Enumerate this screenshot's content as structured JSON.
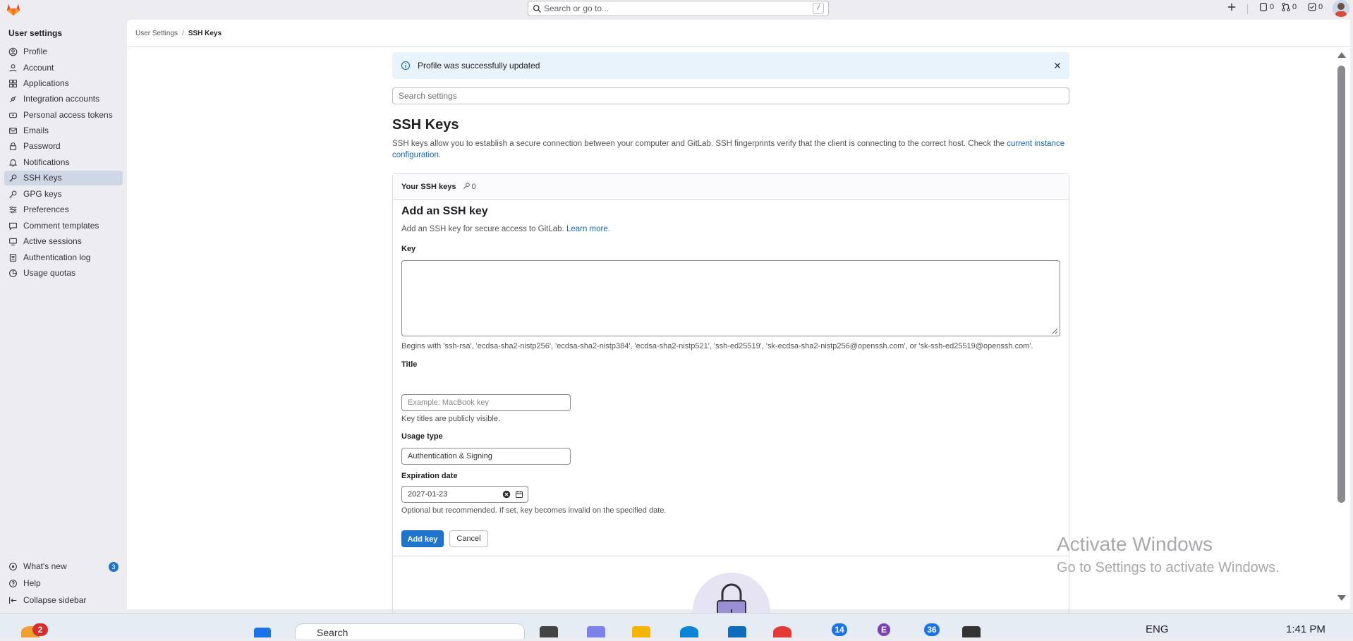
{
  "topbar": {
    "search_placeholder": "Search or go to...",
    "search_shortcut": "/",
    "issues_count": "0",
    "mr_count": "0",
    "todos_count": "0"
  },
  "sidebar": {
    "title": "User settings",
    "items": [
      {
        "label": "Profile",
        "icon": "profile-icon"
      },
      {
        "label": "Account",
        "icon": "account-icon"
      },
      {
        "label": "Applications",
        "icon": "applications-icon"
      },
      {
        "label": "Integration accounts",
        "icon": "integration-icon"
      },
      {
        "label": "Personal access tokens",
        "icon": "token-icon"
      },
      {
        "label": "Emails",
        "icon": "mail-icon"
      },
      {
        "label": "Password",
        "icon": "lock-icon"
      },
      {
        "label": "Notifications",
        "icon": "bell-icon"
      },
      {
        "label": "SSH Keys",
        "icon": "key-icon",
        "active": true
      },
      {
        "label": "GPG keys",
        "icon": "key-icon"
      },
      {
        "label": "Preferences",
        "icon": "preferences-icon"
      },
      {
        "label": "Comment templates",
        "icon": "comment-icon"
      },
      {
        "label": "Active sessions",
        "icon": "monitor-icon"
      },
      {
        "label": "Authentication log",
        "icon": "log-icon"
      },
      {
        "label": "Usage quotas",
        "icon": "quota-icon"
      }
    ],
    "bottom": {
      "whats_new": "What's new",
      "whats_new_badge": "3",
      "help": "Help",
      "collapse": "Collapse sidebar"
    }
  },
  "breadcrumb": {
    "parent": "User Settings",
    "current": "SSH Keys"
  },
  "alert": {
    "message": "Profile was successfully updated"
  },
  "settings_search": {
    "placeholder": "Search settings"
  },
  "page": {
    "title": "SSH Keys",
    "description": "SSH keys allow you to establish a secure connection between your computer and GitLab. SSH fingerprints verify that the client is connecting to the correct host. Check the ",
    "description_link": "current instance configuration",
    "description_end": "."
  },
  "card": {
    "header": "Your SSH keys",
    "key_count": "0",
    "add_title": "Add an SSH key",
    "add_subtitle": "Add an SSH key for secure access to GitLab. ",
    "learn_more": "Learn more.",
    "key_label": "Key",
    "key_help": "Begins with 'ssh-rsa', 'ecdsa-sha2-nistp256', 'ecdsa-sha2-nistp384', 'ecdsa-sha2-nistp521', 'ssh-ed25519', 'sk-ecdsa-sha2-nistp256@openssh.com', or 'sk-ssh-ed25519@openssh.com'.",
    "title_label": "Title",
    "title_placeholder": "Example: MacBook key",
    "title_help": "Key titles are publicly visible.",
    "usage_label": "Usage type",
    "usage_value": "Authentication & Signing",
    "expiration_label": "Expiration date",
    "expiration_value": "2027-01-23",
    "expiration_help": "Optional but recommended. If set, key becomes invalid on the specified date.",
    "add_button": "Add key",
    "cancel_button": "Cancel"
  },
  "watermark": {
    "line1": "Activate Windows",
    "line2": "Go to Settings to activate Windows."
  },
  "taskbar": {
    "weather_badge": "2",
    "search_text": "Search",
    "badge_a": "14",
    "badge_b": "E",
    "badge_c": "36",
    "lang": "ENG",
    "time": "1:41 PM"
  }
}
